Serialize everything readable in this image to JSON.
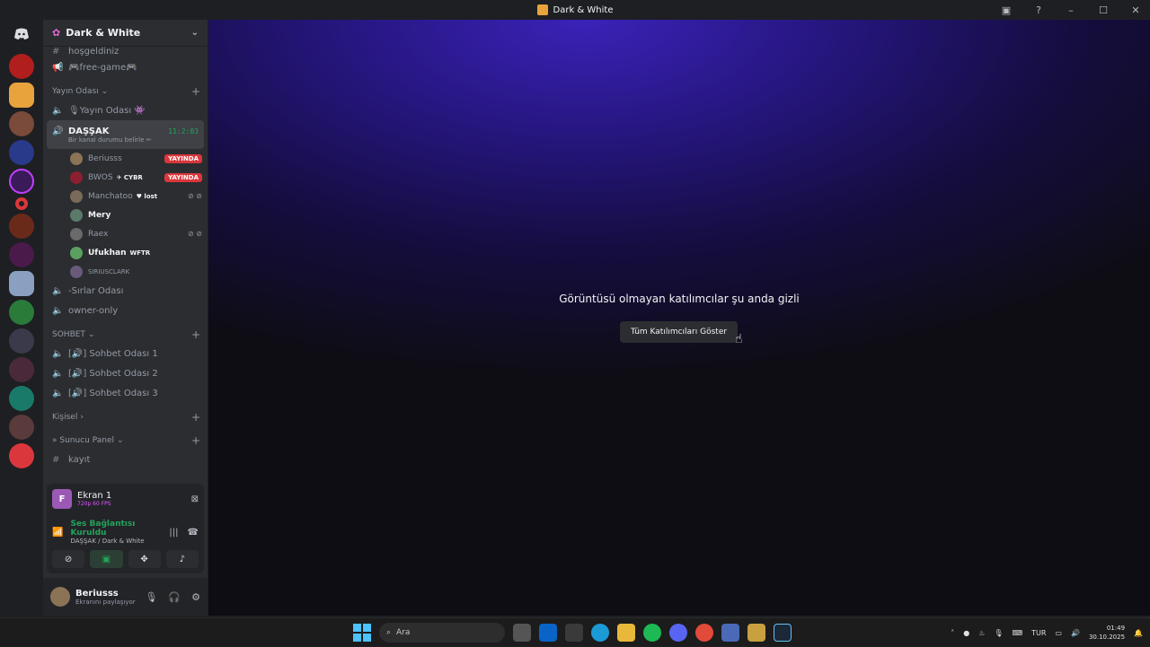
{
  "window": {
    "title": "Dark & White"
  },
  "server": {
    "name": "Dark & White"
  },
  "channels": {
    "top": [
      {
        "name": "hoşgeldiniz"
      },
      {
        "name": "🎮free-game🎮"
      }
    ],
    "cat_yayin": "Yayın Odası",
    "yayin_room": "🎙Yayın Odası 👾",
    "active": {
      "name": "DAŞŞAK",
      "timer": "11:2:03",
      "status": "Bir kanal durumu belirle ✏"
    },
    "members": [
      {
        "name": "Beriusss",
        "badge": "YAYINDA",
        "tag": ""
      },
      {
        "name": "BWOS",
        "badge": "YAYINDA",
        "tag": "✈ CYBR"
      },
      {
        "name": "Manchatoo",
        "badge": "",
        "tag": "♥ lost"
      },
      {
        "name": "Mery",
        "badge": "",
        "tag": ""
      },
      {
        "name": "Raex",
        "badge": "",
        "tag": ""
      },
      {
        "name": "Ufukhan",
        "badge": "",
        "tag": "WFTR"
      },
      {
        "name": "SIRIUSCLARK",
        "badge": "",
        "tag": ""
      }
    ],
    "sirlar": "-Sırlar Odası",
    "owner": "owner-only",
    "cat_sohbet": "SOHBET",
    "sohbet": [
      "[🔊] Sohbet Odası 1",
      "[🔊] Sohbet Odası 2",
      "[🔊] Sohbet Odası 3"
    ],
    "cat_kisisel": "Kişisel",
    "cat_panel": "» Sunucu Panel",
    "kayit": "kayıt"
  },
  "panel": {
    "ekran_title": "Ekran 1",
    "ekran_sub": "720p 60 FPS",
    "voice_status": "Ses Bağlantısı Kuruldu",
    "voice_sub": "DAŞŞAK / Dark & White"
  },
  "user": {
    "name": "Beriusss",
    "status": "Ekranını paylaşıyor"
  },
  "stage": {
    "message": "Görüntüsü olmayan katılımcılar şu anda gizli",
    "button": "Tüm Katılımcıları Göster"
  },
  "taskbar": {
    "search": "Ara",
    "lang": "TUR",
    "time": "01:49",
    "date": "30.10.2025"
  },
  "colors": {
    "accent": "#5865f2",
    "green": "#23a55a",
    "live": "#da373c"
  }
}
